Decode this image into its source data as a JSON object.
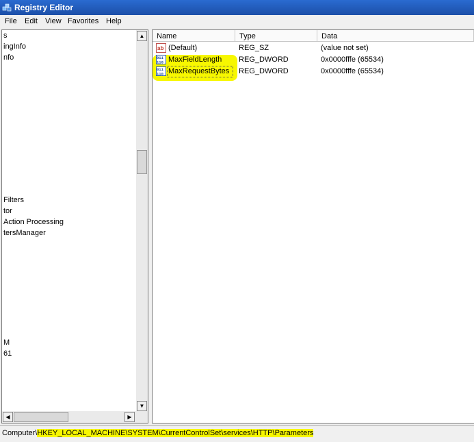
{
  "window": {
    "title": "Registry Editor"
  },
  "menu": [
    "File",
    "Edit",
    "View",
    "Favorites",
    "Help"
  ],
  "tree": {
    "items": [
      "s",
      "ingInfo",
      "nfo",
      "Filters",
      "tor",
      "Action Processing",
      "tersManager",
      "M",
      "61"
    ]
  },
  "list": {
    "columns": [
      "Name",
      "Type",
      "Data"
    ],
    "rows": [
      {
        "name": "(Default)",
        "type": "REG_SZ",
        "data": "(value not set)",
        "icon": "string-value-icon"
      },
      {
        "name": "MaxFieldLength",
        "type": "REG_DWORD",
        "data": "0x0000fffe (65534)",
        "icon": "dword-value-icon"
      },
      {
        "name": "MaxRequestBytes",
        "type": "REG_DWORD",
        "data": "0x0000fffe (65534)",
        "icon": "dword-value-icon"
      }
    ]
  },
  "status": {
    "prefix": "Computer\\",
    "path": "HKEY_LOCAL_MACHINE\\SYSTEM\\CurrentControlSet\\services\\HTTP\\Parameters"
  },
  "highlight_color": "#f7f700"
}
